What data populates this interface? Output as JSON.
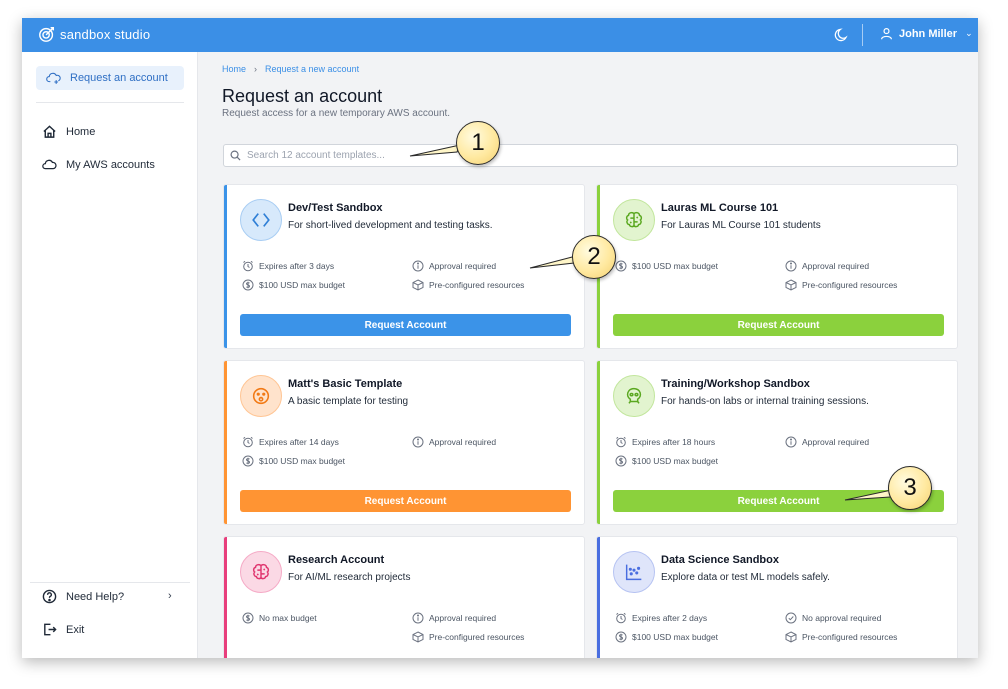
{
  "app": {
    "name": "sandbox studio"
  },
  "header": {
    "user_name": "John Miller"
  },
  "sidebar": {
    "request_label": "Request an account",
    "items": [
      {
        "label": "Home"
      },
      {
        "label": "My AWS accounts"
      }
    ],
    "help_label": "Need Help?",
    "exit_label": "Exit"
  },
  "breadcrumb": {
    "home": "Home",
    "current": "Request a new account"
  },
  "page": {
    "title": "Request an account",
    "subtitle": "Request access for a new temporary AWS account."
  },
  "search": {
    "placeholder": "Search 12 account templates..."
  },
  "cards": [
    {
      "name": "Dev/Test Sandbox",
      "desc": "For short-lived development and testing tasks.",
      "accent": "#3b93e8",
      "features": [
        "Expires after 3 days",
        "Approval required",
        "$100 USD max budget",
        "Pre-configured resources"
      ],
      "button": "Request Account"
    },
    {
      "name": "Lauras ML Course 101",
      "desc": "For Lauras ML Course 101 students",
      "accent": "#8bd13d",
      "features": [
        "$100 USD max budget",
        "Approval required",
        "Pre-configured resources"
      ],
      "button": "Request Account"
    },
    {
      "name": "Matt's Basic Template",
      "desc": "A basic template for testing",
      "accent": "#ff9433",
      "features": [
        "Expires after 14 days",
        "Approval required",
        "$100 USD max budget"
      ],
      "button": "Request Account"
    },
    {
      "name": "Training/Workshop Sandbox",
      "desc": "For hands-on labs or internal training sessions.",
      "accent": "#8bd13d",
      "features": [
        "Expires after 18 hours",
        "Approval required",
        "$100 USD max budget"
      ],
      "button": "Request Account"
    },
    {
      "name": "Research Account",
      "desc": "For AI/ML research projects",
      "accent": "#e83e7c",
      "features": [
        "No max budget",
        "Approval required",
        "Pre-configured resources"
      ]
    },
    {
      "name": "Data Science Sandbox",
      "desc": "Explore data or test ML models safely.",
      "accent": "#4a6ee0",
      "features": [
        "Expires after 2 days",
        "No approval required",
        "$100 USD max budget",
        "Pre-configured resources"
      ]
    }
  ],
  "callouts": [
    "1",
    "2",
    "3"
  ]
}
